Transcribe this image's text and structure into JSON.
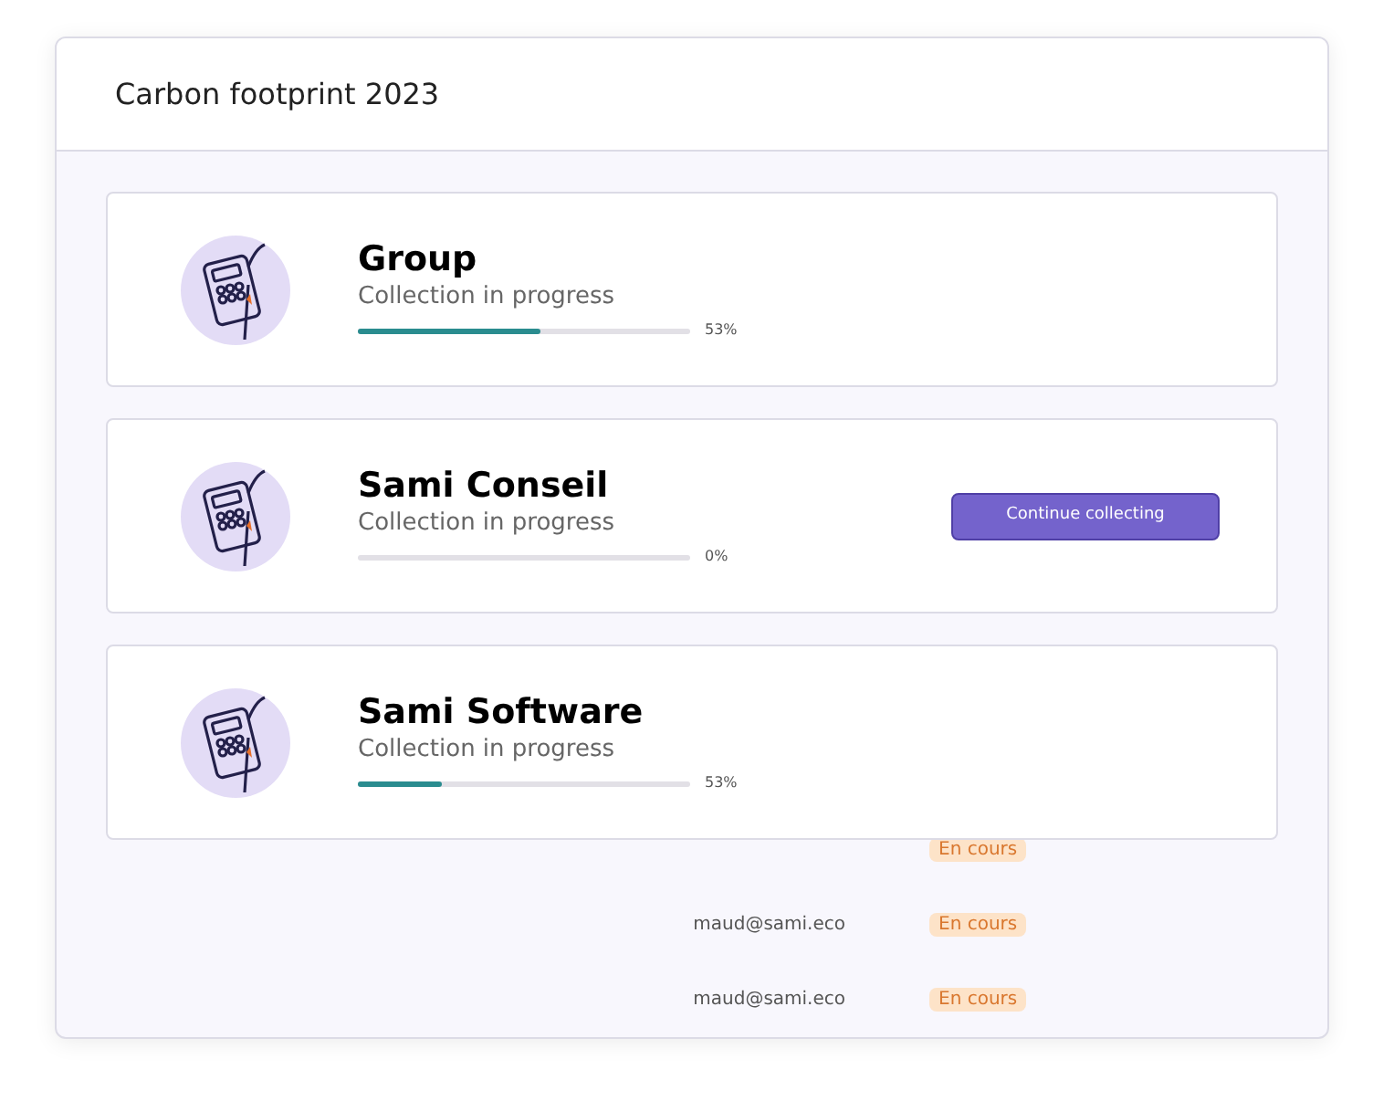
{
  "title": "Carbon footprint 2023",
  "entities": [
    {
      "name": "Group",
      "status": "Collection in progress",
      "level": 0.55,
      "percent": "53%"
    },
    {
      "name": "Sami Conseil",
      "status": "Collection in progress",
      "level": 0,
      "percent": "0%",
      "action": "Continue collecting"
    },
    {
      "name": "Sami Software",
      "status": "Collection in progress",
      "level": 0.25,
      "percent": "53%"
    }
  ],
  "rows": [
    {
      "badge": "En cours"
    },
    {
      "email": "maud@sami.eco",
      "badge": "En cours"
    },
    {
      "email": "maud@sami.eco",
      "badge": "En cours"
    }
  ]
}
